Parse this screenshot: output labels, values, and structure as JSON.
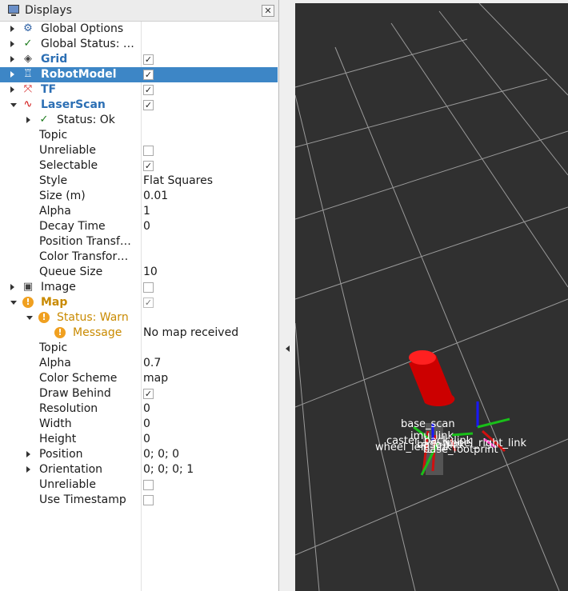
{
  "panel": {
    "title": "Displays",
    "close_glyph": "✕"
  },
  "tree": [
    {
      "id": "global-options",
      "label": "Global Options",
      "indent": 0,
      "arrow": "collapsed",
      "icon": "gear-icon",
      "icon_glyph": "⚙",
      "value": "",
      "check": null,
      "style": "normal"
    },
    {
      "id": "global-status",
      "label": "Global Status: Ok",
      "indent": 0,
      "arrow": "collapsed",
      "icon": "ok-check-icon",
      "icon_glyph": "✓",
      "value": "",
      "check": null,
      "style": "normal"
    },
    {
      "id": "grid",
      "label": "Grid",
      "indent": 0,
      "arrow": "collapsed",
      "icon": "grid-icon",
      "icon_glyph": "◈",
      "value": "",
      "check": true,
      "style": "bold"
    },
    {
      "id": "robotmodel",
      "label": "RobotModel",
      "indent": 0,
      "arrow": "collapsed",
      "icon": "robot-icon",
      "icon_glyph": "♖",
      "value": "",
      "check": true,
      "style": "bold",
      "selected": true
    },
    {
      "id": "tf",
      "label": "TF",
      "indent": 0,
      "arrow": "collapsed",
      "icon": "tf-axes-icon",
      "icon_glyph": "⤧",
      "value": "",
      "check": true,
      "style": "bold"
    },
    {
      "id": "laserscan",
      "label": "LaserScan",
      "indent": 0,
      "arrow": "expanded",
      "icon": "laserscan-icon",
      "icon_glyph": "∿",
      "value": "",
      "check": true,
      "style": "bold"
    },
    {
      "id": "laserscan-status",
      "label": "Status: Ok",
      "indent": 1,
      "arrow": "collapsed",
      "icon": "ok-check-icon",
      "icon_glyph": "✓",
      "value": "",
      "check": null,
      "style": "normal"
    },
    {
      "id": "laserscan-topic",
      "label": "Topic",
      "indent": 1,
      "arrow": null,
      "icon": null,
      "value": "",
      "check": null,
      "style": "normal"
    },
    {
      "id": "laserscan-unreliable",
      "label": "Unreliable",
      "indent": 1,
      "arrow": null,
      "icon": null,
      "value": "",
      "check": false,
      "style": "normal"
    },
    {
      "id": "laserscan-selectable",
      "label": "Selectable",
      "indent": 1,
      "arrow": null,
      "icon": null,
      "value": "",
      "check": true,
      "style": "normal"
    },
    {
      "id": "laserscan-style",
      "label": "Style",
      "indent": 1,
      "arrow": null,
      "icon": null,
      "value": "Flat Squares",
      "check": null,
      "style": "normal"
    },
    {
      "id": "laserscan-size",
      "label": "Size (m)",
      "indent": 1,
      "arrow": null,
      "icon": null,
      "value": "0.01",
      "check": null,
      "style": "normal"
    },
    {
      "id": "laserscan-alpha",
      "label": "Alpha",
      "indent": 1,
      "arrow": null,
      "icon": null,
      "value": "1",
      "check": null,
      "style": "normal"
    },
    {
      "id": "laserscan-decay",
      "label": "Decay Time",
      "indent": 1,
      "arrow": null,
      "icon": null,
      "value": "0",
      "check": null,
      "style": "normal"
    },
    {
      "id": "laserscan-position-transformer",
      "label": "Position Transf…",
      "indent": 1,
      "arrow": null,
      "icon": null,
      "value": "",
      "check": null,
      "style": "normal"
    },
    {
      "id": "laserscan-color-transformer",
      "label": "Color Transfor…",
      "indent": 1,
      "arrow": null,
      "icon": null,
      "value": "",
      "check": null,
      "style": "normal"
    },
    {
      "id": "laserscan-queue",
      "label": "Queue Size",
      "indent": 1,
      "arrow": null,
      "icon": null,
      "value": "10",
      "check": null,
      "style": "normal"
    },
    {
      "id": "image",
      "label": "Image",
      "indent": 0,
      "arrow": "collapsed",
      "icon": "image-icon",
      "icon_glyph": "▣",
      "value": "",
      "check": false,
      "style": "normal"
    },
    {
      "id": "map",
      "label": "Map",
      "indent": 0,
      "arrow": "expanded",
      "icon": "warning-icon",
      "icon_glyph": "!",
      "value": "",
      "check": true,
      "style": "warn-bold"
    },
    {
      "id": "map-status",
      "label": "Status: Warn",
      "indent": 1,
      "arrow": "expanded",
      "icon": "warning-icon",
      "icon_glyph": "!",
      "value": "",
      "check": null,
      "style": "warn"
    },
    {
      "id": "map-message",
      "label": "Message",
      "indent": 2,
      "arrow": null,
      "icon": "warning-icon",
      "icon_glyph": "!",
      "value": "No map received",
      "check": null,
      "style": "warn"
    },
    {
      "id": "map-topic",
      "label": "Topic",
      "indent": 1,
      "arrow": null,
      "icon": null,
      "value": "",
      "check": null,
      "style": "normal"
    },
    {
      "id": "map-alpha",
      "label": "Alpha",
      "indent": 1,
      "arrow": null,
      "icon": null,
      "value": "0.7",
      "check": null,
      "style": "normal"
    },
    {
      "id": "map-color-scheme",
      "label": "Color Scheme",
      "indent": 1,
      "arrow": null,
      "icon": null,
      "value": "map",
      "check": null,
      "style": "normal"
    },
    {
      "id": "map-draw-behind",
      "label": "Draw Behind",
      "indent": 1,
      "arrow": null,
      "icon": null,
      "value": "",
      "check": true,
      "style": "normal"
    },
    {
      "id": "map-resolution",
      "label": "Resolution",
      "indent": 1,
      "arrow": null,
      "icon": null,
      "value": "0",
      "check": null,
      "style": "normal"
    },
    {
      "id": "map-width",
      "label": "Width",
      "indent": 1,
      "arrow": null,
      "icon": null,
      "value": "0",
      "check": null,
      "style": "normal"
    },
    {
      "id": "map-height",
      "label": "Height",
      "indent": 1,
      "arrow": null,
      "icon": null,
      "value": "0",
      "check": null,
      "style": "normal"
    },
    {
      "id": "map-position",
      "label": "Position",
      "indent": 1,
      "arrow": "collapsed",
      "icon": null,
      "value": "0; 0; 0",
      "check": null,
      "style": "normal"
    },
    {
      "id": "map-orientation",
      "label": "Orientation",
      "indent": 1,
      "arrow": "collapsed",
      "icon": null,
      "value": "0; 0; 0; 1",
      "check": null,
      "style": "normal"
    },
    {
      "id": "map-unreliable",
      "label": "Unreliable",
      "indent": 1,
      "arrow": null,
      "icon": null,
      "value": "",
      "check": false,
      "style": "normal"
    },
    {
      "id": "map-use-timestamp",
      "label": "Use Timestamp",
      "indent": 1,
      "arrow": null,
      "icon": null,
      "value": "",
      "check": false,
      "style": "normal"
    }
  ],
  "viewport": {
    "background": "#303030",
    "grid_color": "#a0a0a0",
    "frame_labels": [
      "base_scan",
      "imu_link",
      "caster_back_link",
      "wheel_left_link",
      "base_link",
      "base_footprint",
      "wheel_right_link"
    ]
  }
}
